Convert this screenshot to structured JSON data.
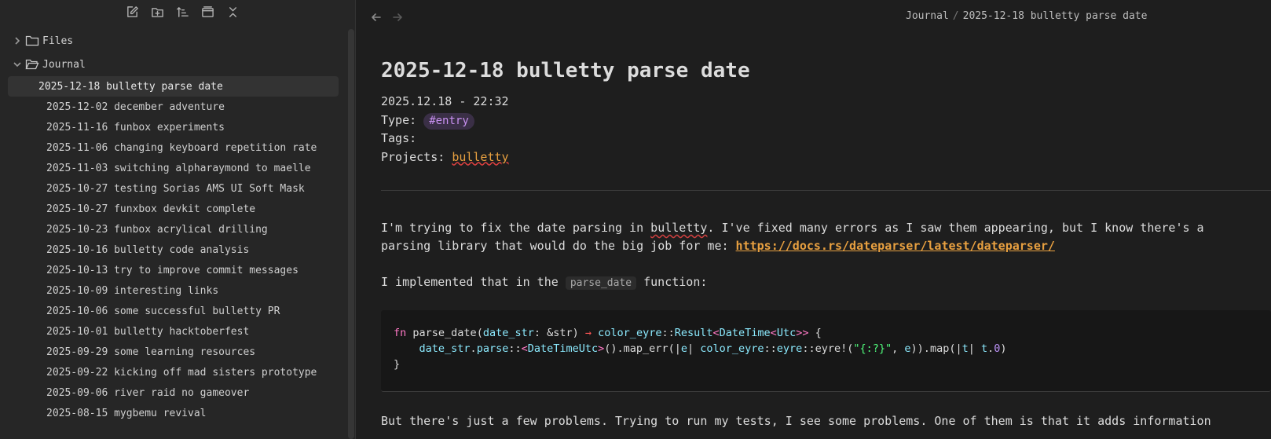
{
  "sidebar": {
    "toolbar": [
      {
        "name": "new-note-icon"
      },
      {
        "name": "new-folder-icon"
      },
      {
        "name": "sort-icon"
      },
      {
        "name": "collapse-view-icon"
      },
      {
        "name": "collapse-all-icon"
      }
    ],
    "folders": {
      "files": "Files",
      "journal": "Journal"
    },
    "journal_items": [
      "2025-12-18 bulletty parse date",
      "2025-12-02 december adventure",
      "2025-11-16 funbox experiments",
      "2025-11-06 changing keyboard repetition rate",
      "2025-11-03 switching alpharaymond to maelle",
      "2025-10-27 testing Sorias AMS UI Soft Mask",
      "2025-10-27 funxbox devkit complete",
      "2025-10-23 funbox acrylical drilling",
      "2025-10-16 bulletty code analysis",
      "2025-10-13 try to improve commit messages",
      "2025-10-09 interesting links",
      "2025-10-06 some successful bulletty PR",
      "2025-10-01 bulletty hacktoberfest",
      "2025-09-29 some learning resources",
      "2025-09-22 kicking off mad sisters prototype",
      "2025-09-06 river raid no gameover",
      "2025-08-15 mygbemu revival"
    ],
    "active_index": 0
  },
  "breadcrumb": {
    "folder": "Journal",
    "separator": "/",
    "note": "2025-12-18 bulletty parse date"
  },
  "document": {
    "title": "2025-12-18 bulletty parse date",
    "datetime": "2025.12.18 - 22:32",
    "type_label": "Type:",
    "type_tag": "#entry",
    "tags_label": "Tags:",
    "projects_label": "Projects:",
    "project": "bulletty",
    "p1_a": "I'm trying to fix the date parsing in ",
    "p1_word": "bulletty",
    "p1_b": ". I've fixed many errors as I saw them appearing, but I know there's a",
    "p1_c": "parsing library that would do the big job for me: ",
    "p1_link": "https://docs.rs/dateparser/latest/dateparser/",
    "p2_a": "I implemented that in the ",
    "p2_code": "parse_date",
    "p2_b": " function:",
    "p3": "But there's just a few problems. Trying to run my tests, I see some problems. One of them is that it adds information"
  },
  "colors": {
    "accent_link": "#e8a040",
    "tag_text": "#c890f0"
  }
}
